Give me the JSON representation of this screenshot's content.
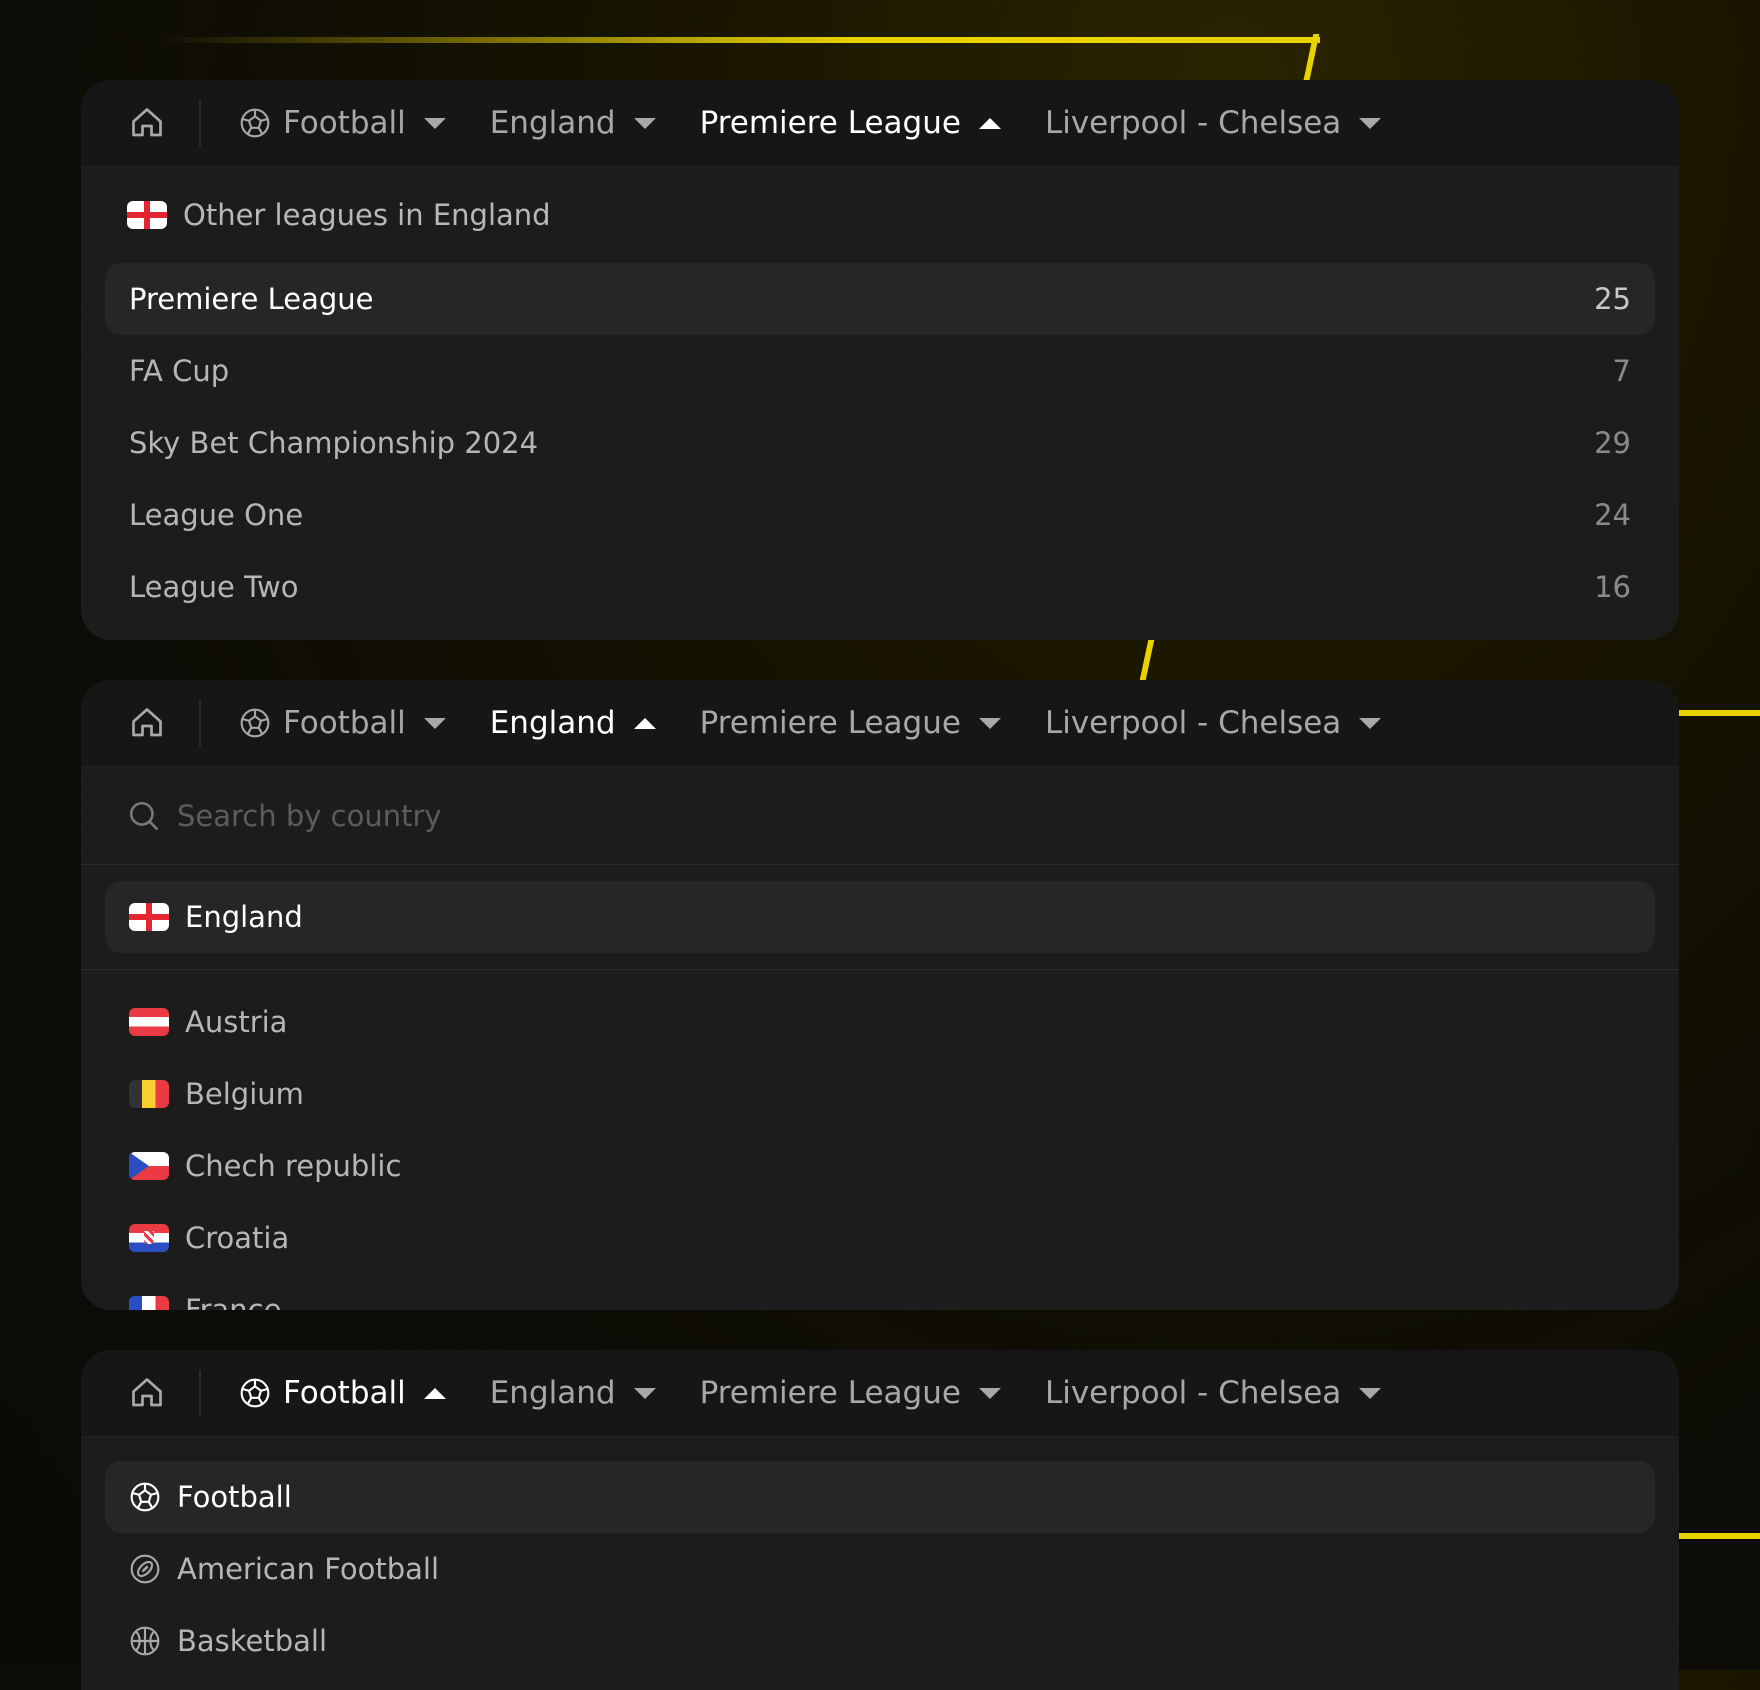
{
  "colors": {
    "accent": "#e8d200",
    "panel": "#1c1c1c",
    "bar": "#161616",
    "selected": "#262626"
  },
  "panel1": {
    "breadcrumb": [
      {
        "label": "Football",
        "icon": "soccer-ball-icon",
        "state": "collapsed"
      },
      {
        "label": "England",
        "state": "collapsed"
      },
      {
        "label": "Premiere League",
        "state": "expanded"
      },
      {
        "label": "Liverpool - Chelsea",
        "state": "collapsed"
      }
    ],
    "section_title": "Other leagues in England",
    "leagues": [
      {
        "name": "Premiere League",
        "count": "25"
      },
      {
        "name": "FA Cup",
        "count": "7"
      },
      {
        "name": "Sky Bet Championship 2024",
        "count": "29"
      },
      {
        "name": "League One",
        "count": "24"
      },
      {
        "name": "League Two",
        "count": "16"
      }
    ]
  },
  "panel2": {
    "breadcrumb": [
      {
        "label": "Football",
        "icon": "soccer-ball-icon",
        "state": "collapsed"
      },
      {
        "label": "England",
        "state": "expanded"
      },
      {
        "label": "Premiere League",
        "state": "collapsed"
      },
      {
        "label": "Liverpool - Chelsea",
        "state": "collapsed"
      }
    ],
    "search_placeholder": "Search by country",
    "selected_country": "England",
    "countries": [
      "Austria",
      "Belgium",
      "Chech republic",
      "Croatia",
      "France"
    ]
  },
  "panel3": {
    "breadcrumb": [
      {
        "label": "Football",
        "icon": "soccer-ball-icon",
        "state": "expanded"
      },
      {
        "label": "England",
        "state": "collapsed"
      },
      {
        "label": "Premiere League",
        "state": "collapsed"
      },
      {
        "label": "Liverpool - Chelsea",
        "state": "collapsed"
      }
    ],
    "sports": [
      {
        "name": "Football",
        "icon": "soccer-ball-icon"
      },
      {
        "name": "American Football",
        "icon": "american-football-icon"
      },
      {
        "name": "Basketball",
        "icon": "basketball-icon"
      }
    ]
  }
}
